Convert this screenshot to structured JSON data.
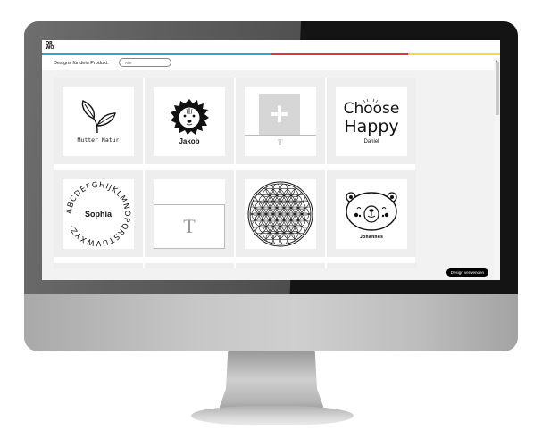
{
  "app": {
    "logo_line1": "OR",
    "logo_line2": "WO"
  },
  "brand_colors": {
    "blue": "#29a6cf",
    "red": "#d8373b",
    "yellow": "#f5d92c"
  },
  "filter": {
    "label": "Designs für dein Produkt:",
    "selected": "Alle",
    "chevron_icon": "chevron-down-icon"
  },
  "designs": [
    {
      "id": "mutter-natur",
      "caption": "Mutter Natur",
      "icon": "leaves-icon"
    },
    {
      "id": "jakob",
      "caption": "Jakob",
      "icon": "lion-icon"
    },
    {
      "id": "custom-image-text",
      "caption": "T",
      "icon": "plus-icon"
    },
    {
      "id": "choose-happy",
      "caption": "Daniel",
      "title_line1": "Choose",
      "title_line2": "Happy",
      "icon": "choose-happy-icon"
    },
    {
      "id": "alphabet-circle",
      "caption": "Sophia",
      "ring_text": "ABCDEFGHIJKLMNOPQRSTUVWXYZ·",
      "icon": "alphabet-ring-icon"
    },
    {
      "id": "custom-text",
      "caption": "T",
      "icon": "text-icon"
    },
    {
      "id": "flower-of-life",
      "caption": "",
      "icon": "flower-of-life-icon"
    },
    {
      "id": "bear",
      "caption": "Johannes",
      "icon": "bear-icon"
    }
  ],
  "actions": {
    "use_design": "Design verwenden"
  }
}
